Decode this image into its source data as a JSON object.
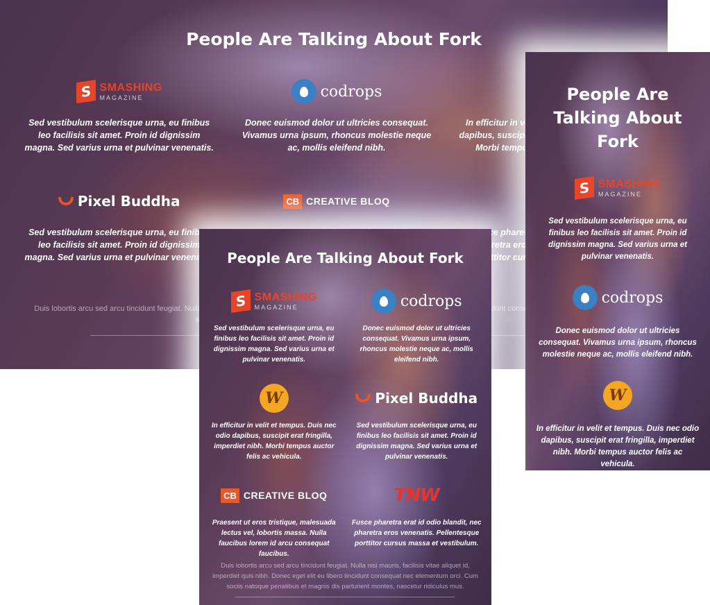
{
  "heading": "People Are Talking About Fork",
  "logos": {
    "smashing": {
      "mark": "S",
      "line1": "SMASHING",
      "line2": "MAGAZINE"
    },
    "codrops": {
      "text": "codrops"
    },
    "pixelbuddha": {
      "text": "Pixel Buddha"
    },
    "creativebloq": {
      "mark": "CB",
      "text": "CREATIVE BLOQ"
    },
    "w": {
      "mark": "W"
    },
    "tnw": {
      "text": "TNW"
    }
  },
  "quotes": {
    "smashing": "Sed vestibulum scelerisque urna, eu finibus leo facilisis sit amet. Proin id dignissim magna. Sed varius urna et pulvinar venenatis.",
    "codrops": "Donec euismod dolor ut ultricies consequat. Vivamus urna ipsum, rhoncus molestie neque ac, mollis eleifend nibh.",
    "w": "In efficitur in velit et tempus. Duis nec odio dapibus, suscipit erat fringilla, imperdiet nibh. Morbi tempus auctor felis ac vehicula.",
    "pixelbuddha": "Sed vestibulum scelerisque urna, eu finibus leo facilisis sit amet. Proin id dignissim magna. Sed varius urna et pulvinar venenatis.",
    "creativebloq": "Praesent ut eros tristique, malesuada lectus vel, lobortis massa. Nulla faucibus lorem id arcu consequat faucibus.",
    "tnw": "Fusce pharetra erat id odio blandit, nec pharetra eros venenatis. Pellentesque porttitor cursus massa et vestibulum."
  },
  "footnote": "Duis lobortis arcu sed arcu tincidunt feugiat. Nulla nisi mauris, facilisis vitae aliquet id, imperdiet quis nibh. Donec eget elit eu libero tincidunt consequat nec elementum orci. Cum sociis natoque penatibus et magnis dis parturient montes, nascetur ridiculus mus.",
  "colors": {
    "smashing": "#e7452a",
    "codrops": "#3a80c3",
    "pixelbuddha": "#e7562b",
    "creativebloq": "#e9582a",
    "w": "#f5a623",
    "tnw": "#e9332c"
  }
}
